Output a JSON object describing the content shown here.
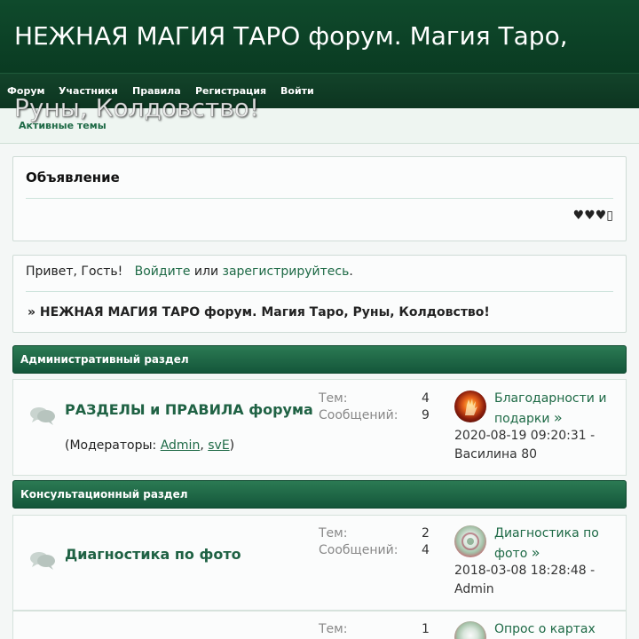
{
  "site": {
    "title_line1": "НЕЖНАЯ МАГИЯ ТАРО форум. Магия Таро,",
    "title_line2": "Руны, Колдовство!"
  },
  "nav": {
    "items": [
      {
        "label": "Форум"
      },
      {
        "label": "Участники"
      },
      {
        "label": "Правила"
      },
      {
        "label": "Регистрация"
      },
      {
        "label": "Войти"
      }
    ]
  },
  "subnav": {
    "active_topics": "Активные темы"
  },
  "announcement": {
    "title": "Объявление",
    "content": "♥♥♥▯"
  },
  "greeting": {
    "prefix": "Привет, Гость!",
    "login_link": "Войдите",
    "or": "или",
    "register_link": "зарегистрируйтесь",
    "suffix": ".",
    "breadcrumb": "» НЕЖНАЯ МАГИЯ ТАРО форум. Магия Таро, Руны, Колдовство!"
  },
  "labels": {
    "topics": "Тем:",
    "posts": "Сообщений:",
    "arrow": "»"
  },
  "categories": [
    {
      "title": "Административный раздел",
      "forums": [
        {
          "name": "РАЗДЕЛЫ и ПРАВИЛА форума",
          "moderators_prefix": "(Модераторы:",
          "moderator1": "Admin",
          "sep": ",",
          "moderator2": "svE",
          "moderators_suffix": ")",
          "topics": "4",
          "posts": "9",
          "last_title_line1": "Благодарности и",
          "last_title_line2": "подарки",
          "last_date": "2020-08-19 09:20:31 -",
          "last_author": "Василина 80"
        }
      ]
    },
    {
      "title": "Консультационный раздел",
      "forums": [
        {
          "name": "Диагностика по фото",
          "topics": "2",
          "posts": "4",
          "last_title_line1": "Диагностика по",
          "last_title_line2": "фото",
          "last_date": "2018-03-08 18:28:48 -",
          "last_author": "Admin"
        },
        {
          "topics": "1",
          "last_title_line1": "Опрос о картах"
        }
      ]
    }
  ],
  "colors": {
    "header": "#0f4a2c",
    "accent": "#1e6a46",
    "category": "#2b7a53"
  }
}
